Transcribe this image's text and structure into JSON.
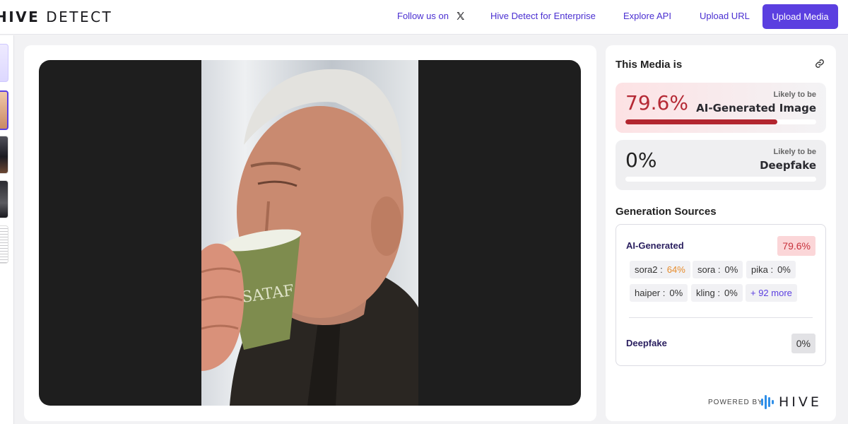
{
  "header": {
    "logo_prefix": "HIVE",
    "logo_suffix": "DETECT",
    "follow_label": "Follow us on",
    "enterprise_label": "Hive Detect for Enterprise",
    "api_label": "Explore API",
    "upload_url_label": "Upload URL",
    "upload_media_label": "Upload Media"
  },
  "result": {
    "title": "This Media is",
    "ai": {
      "score": "79.6%",
      "likely": "Likely to be",
      "verdict": "AI-Generated Image",
      "fraction": 0.796
    },
    "deepfake": {
      "score": "0%",
      "likely": "Likely to be",
      "verdict": "Deepfake",
      "fraction": 0
    }
  },
  "sources": {
    "title": "Generation Sources",
    "ai_label": "AI-Generated",
    "ai_score": "79.6%",
    "chips": [
      {
        "name": "sora2 :",
        "value": "64%"
      },
      {
        "name": "sora :",
        "value": "0%"
      },
      {
        "name": "pika :",
        "value": "0%"
      },
      {
        "name": "haiper :",
        "value": "0%"
      },
      {
        "name": "kling :",
        "value": "0%"
      }
    ],
    "more_label": "+ 92 more",
    "deepfake_label": "Deepfake",
    "deepfake_score": "0%"
  },
  "footer": {
    "powered_by": "POWERED BY",
    "brand": "HIVE"
  },
  "colors": {
    "accent": "#5b3fe0",
    "ai_red": "#b3262f",
    "warning_orange": "#e78c2c"
  },
  "icons": [
    "x-logo-icon",
    "link-icon",
    "hive-logo-icon"
  ]
}
